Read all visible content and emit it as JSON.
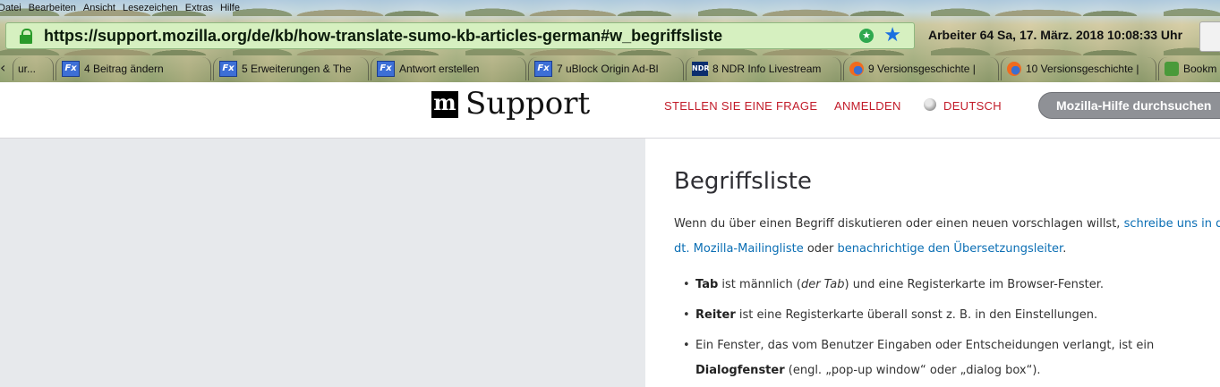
{
  "menu": [
    "Datei",
    "Bearbeiten",
    "Ansicht",
    "Lesezeichen",
    "Extras",
    "Hilfe"
  ],
  "urlbar": {
    "url": "https://support.mozilla.org/de/kb/how-translate-sumo-kb-articles-german#w_begriffsliste"
  },
  "status_clock": "Arbeiter 64 Sa, 17. März. 2018 10:08:33 Uhr",
  "tabs": [
    {
      "label": "ur...",
      "icon": "none"
    },
    {
      "label": "4 Beitrag ändern",
      "icon": "fx-icon"
    },
    {
      "label": "5 Erweiterungen & The",
      "icon": "fx-icon"
    },
    {
      "label": "Antwort erstellen",
      "icon": "fx-icon"
    },
    {
      "label": "7 uBlock Origin Ad-Bl",
      "icon": "fx-icon"
    },
    {
      "label": "8 NDR Info Livestream",
      "icon": "ndr-icon"
    },
    {
      "label": "9 Versionsgeschichte |",
      "icon": "firefox-icon"
    },
    {
      "label": "10 Versionsgeschichte |",
      "icon": "firefox-icon"
    },
    {
      "label": "Bookm",
      "icon": "green-icon"
    }
  ],
  "header": {
    "logo_mark": "m",
    "logo_text": "Support",
    "nav": [
      "STELLEN SIE EINE FRAGE",
      "ANMELDEN",
      "DEUTSCH"
    ],
    "search_placeholder": "Mozilla-Hilfe durchsuchen"
  },
  "article": {
    "title": "Begriffsliste",
    "intro_text_1": "Wenn du über einen Begriff diskutieren oder einen neuen vorschlagen willst, ",
    "intro_link_1a": "schreibe uns in d",
    "intro_link_1b": "dt. Mozilla-Mailingliste",
    "intro_text_2": " oder ",
    "intro_link_2": "benachrichtige den Übersetzungsleiter",
    "intro_text_3": ".",
    "items": [
      {
        "term": "Tab",
        "text_a": " ist männlich (",
        "italic": "der Tab",
        "text_b": ") und eine Registerkarte im Browser-Fenster."
      },
      {
        "term": "Reiter",
        "text_a": " ist eine Registerkarte überall sonst z. B. in den Einstellungen."
      },
      {
        "text_pre": "Ein Fenster, das vom Benutzer Eingaben oder Entscheidungen verlangt, ist ein",
        "term": "Dialogfenster",
        "text_post": " (engl. „pop-up window“ oder „dialog box“)."
      }
    ]
  },
  "colors": {
    "nav_red": "#c21b29",
    "link_blue": "#0a6eb4",
    "urlbar_green": "#d6f0c0",
    "left_panel_gray": "#e7e9ec"
  }
}
